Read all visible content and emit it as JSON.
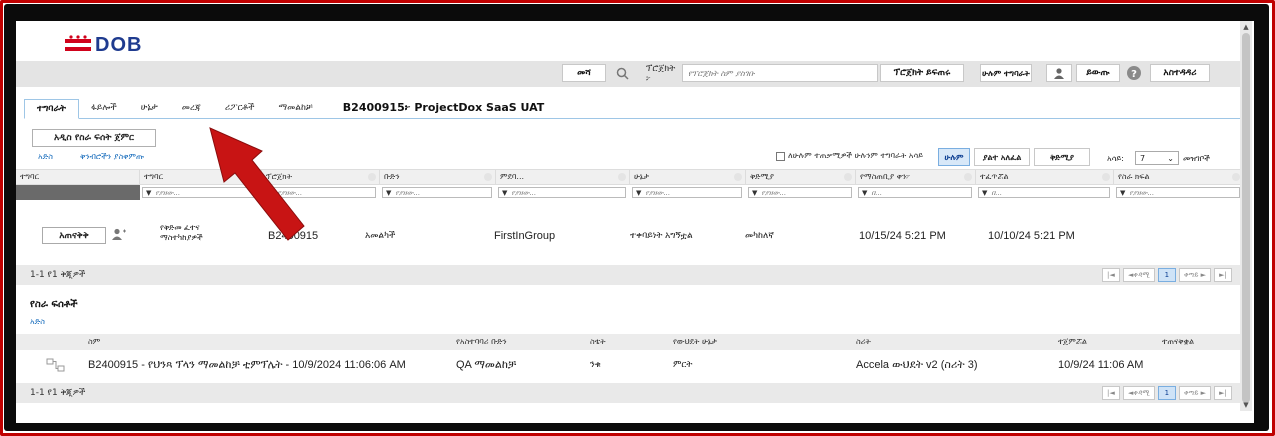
{
  "header": {
    "logo_text": "DOB",
    "search_button": "መሻ",
    "search_label": "ፕሮጀክት ፦",
    "search_placeholder": "የፕሮጀክት ስም ያስገቡ",
    "project_dropdown": "ፕሮጀክት ይፍጠሩ",
    "all_tasks": "ሁሉም ተግባራት",
    "logout": "ይውጡ",
    "help": "አስተዳዳሪ"
  },
  "tabs": [
    {
      "label": "ተግባራት"
    },
    {
      "label": "ፋይሎች"
    },
    {
      "label": "ሁኔታ"
    },
    {
      "label": "መረጃ"
    },
    {
      "label": "ሪፖርቶች"
    },
    {
      "label": "ማመልከቻ"
    }
  ],
  "project_title": "B2400915፦ ProjectDox SaaS UAT",
  "toolbar": {
    "start_button": "አዲስ የስራ ፍሰት ጀምር",
    "refresh_link": "አድስ",
    "reset_link": "ቅንብሮችን ያስቀምጡ",
    "checkbox_label": "ለሁሉም ተጠቃሚዎች ሁሉንም ተግባራት አሳይ",
    "filter_all": "ሁሉም",
    "filter_unassigned": "ያልተ አለፈል",
    "filter_priority": "ቅድሚያ",
    "page_size_label": "አሳይ:",
    "page_size_value": "7",
    "page_size_suffix": "መዝገቦች"
  },
  "grid": {
    "columns": [
      "ተግባር",
      "ተግባር",
      "ፕሮጀክት",
      "ቡድን",
      "ምደባ...",
      "ሁኔታ",
      "ቅድሚያ",
      "የማስጠቢያ ቀን፦",
      "ተፈጥሯል",
      "የስራ ክፍል"
    ],
    "filter_placeholder": "የያዘው...",
    "filter_placeholder_short": "በ...",
    "rows": [
      {
        "action": "አጠናቅቅ",
        "task": "የቅድመ ፈተና ማስተካከያዎች",
        "project": "B2400915",
        "group": "አመልካች",
        "assigned": "FirstInGroup",
        "status": "ተቀባይነት አግኝቷል",
        "priority": "መካከለኛ",
        "due": "10/15/24 5:21 PM",
        "created": "10/10/24 5:21 PM"
      }
    ],
    "pager_text": "1-1 የ1 ቅጂዎች",
    "pager": {
      "first": "|◄",
      "prev": "◄ቀዳሚ",
      "current": "1",
      "next": "ቀጣይ ►",
      "last": "►|"
    }
  },
  "workflows": {
    "title": "የስራ ፍሰቶች",
    "refresh_link": "አድስ",
    "columns": [
      "ስም",
      "የአስተባባሪ ቡድን",
      "ስቴት",
      "የውህደት ሁኔታ",
      "ስሪት",
      "ተጀምሯል",
      "ተጠናቅቋል"
    ],
    "rows": [
      {
        "name": "B2400915 - የህንጻ ፕላን ማመልከቻ ቲምፕሌት - 10/9/2024 11:06:06 AM",
        "group": "QA ማመልከቻ",
        "state": "ንቁ",
        "sync": "ምርት",
        "version": "Accela ውህደት v2 (ስሪት 3)",
        "started": "10/9/24 11:06 AM",
        "completed": ""
      }
    ],
    "pager_text": "1-1 የ1 ቅጂዎች"
  },
  "colors": {
    "frame_red": "#c00000",
    "link_blue": "#1a6ebd",
    "arrow_red": "#c81414"
  }
}
